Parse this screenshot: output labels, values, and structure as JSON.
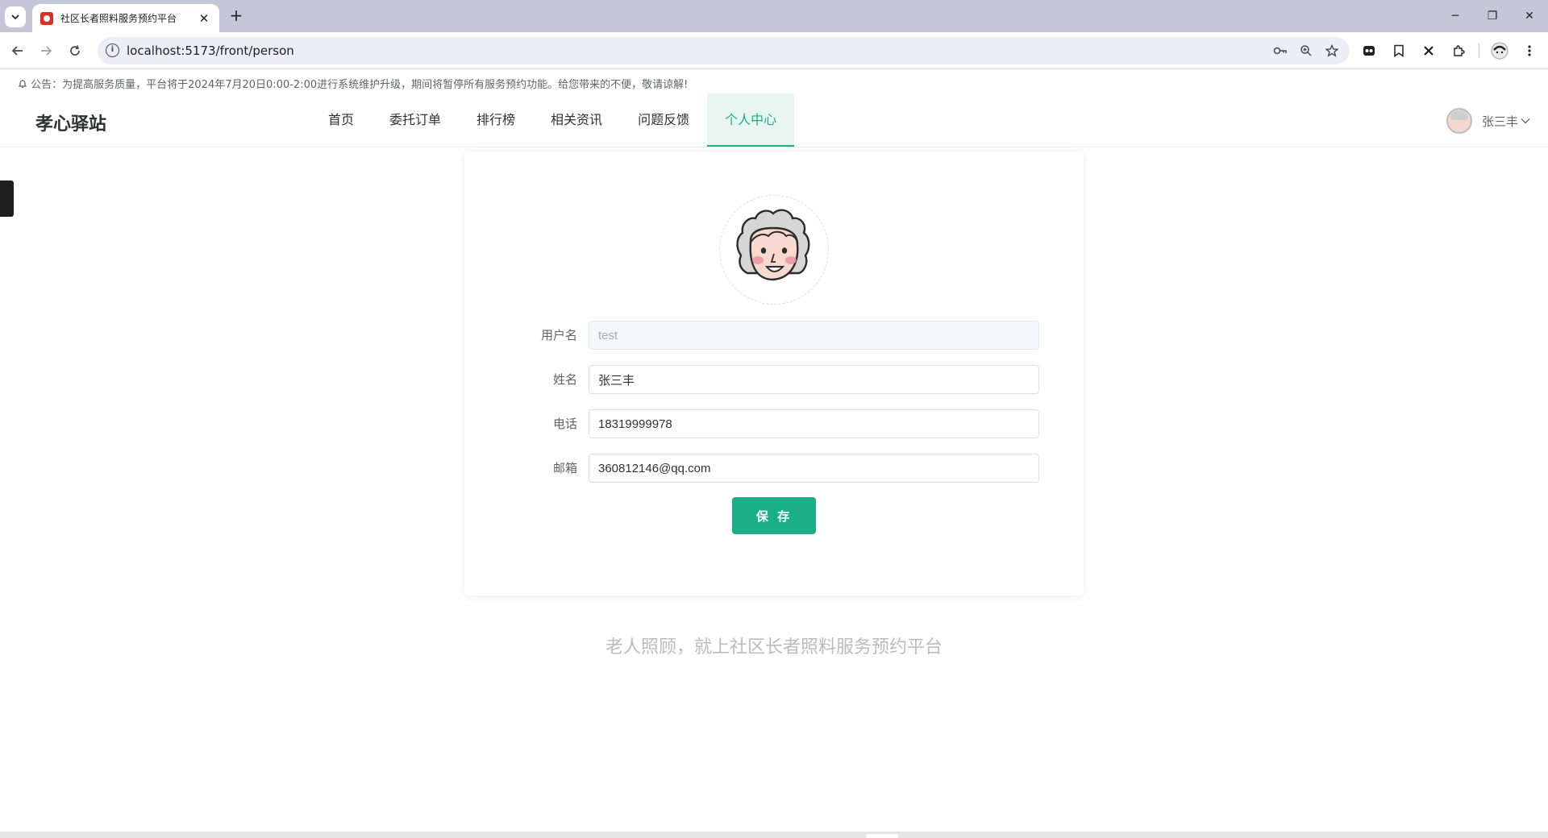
{
  "browser": {
    "tab_title": "社区长者照料服务预约平台",
    "tab_close": "✕",
    "new_tab": "+",
    "url": "localhost:5173/front/person",
    "window": {
      "minimize": "─",
      "restore": "❐",
      "close": "✕"
    }
  },
  "notice": {
    "text": "公告：为提高服务质量，平台将于2024年7月20日0:00-2:00进行系统维护升级，期间将暂停所有服务预约功能。给您带来的不便，敬请谅解!"
  },
  "header": {
    "logo": "孝心驿站",
    "nav": [
      "首页",
      "委托订单",
      "排行榜",
      "相关资讯",
      "问题反馈",
      "个人中心"
    ],
    "active_nav": "个人中心",
    "user_name": "张三丰"
  },
  "form": {
    "username_label": "用户名",
    "username_value": "test",
    "name_label": "姓名",
    "name_value": "张三丰",
    "phone_label": "电话",
    "phone_value": "18319999978",
    "email_label": "邮箱",
    "email_value": "360812146@qq.com",
    "save_label": "保 存"
  },
  "footer": {
    "slogan": "老人照顾，就上社区长者照料服务预约平台"
  },
  "colors": {
    "accent": "#1aaf87",
    "accent_bg": "#e8f5f0"
  }
}
